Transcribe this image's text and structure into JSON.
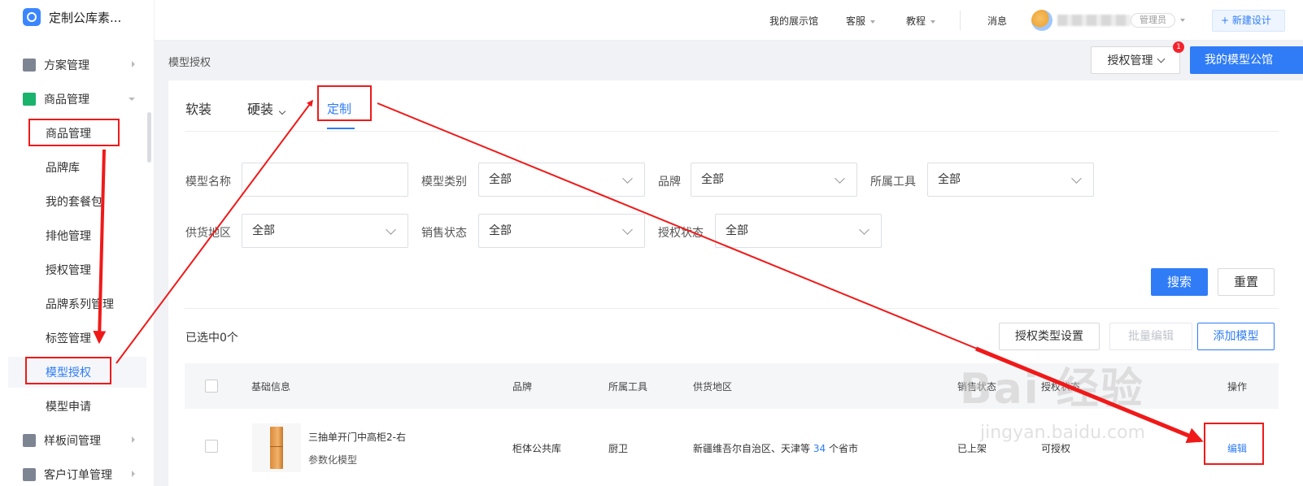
{
  "app": {
    "title": "定制公库素..."
  },
  "sidebar": {
    "groups": [
      {
        "label": "方案管理"
      },
      {
        "label": "商品管理"
      },
      {
        "label": "样板间管理"
      },
      {
        "label": "客户订单管理"
      }
    ],
    "sub_items": [
      {
        "label": "商品管理"
      },
      {
        "label": "品牌库"
      },
      {
        "label": "我的套餐包"
      },
      {
        "label": "排他管理"
      },
      {
        "label": "授权管理"
      },
      {
        "label": "品牌系列管理"
      },
      {
        "label": "标签管理"
      },
      {
        "label": "模型授权"
      },
      {
        "label": "模型申请"
      }
    ]
  },
  "topbar": {
    "showroom": "我的展示馆",
    "service": "客服",
    "tutorial": "教程",
    "messages": "消息",
    "role": "管理员",
    "new_design": "+ 新建设计"
  },
  "header": {
    "breadcrumb": "模型授权",
    "auth_manage": "授权管理",
    "badge_count": "1",
    "my_library": "我的模型公馆"
  },
  "tabs": [
    {
      "label": "软装"
    },
    {
      "label": "硬装"
    },
    {
      "label": "定制"
    }
  ],
  "filters": {
    "model_name": {
      "label": "模型名称",
      "value": ""
    },
    "model_type": {
      "label": "模型类别",
      "value": "全部"
    },
    "brand": {
      "label": "品牌",
      "value": "全部"
    },
    "tool": {
      "label": "所属工具",
      "value": "全部"
    },
    "region": {
      "label": "供货地区",
      "value": "全部"
    },
    "sale_status": {
      "label": "销售状态",
      "value": "全部"
    },
    "auth_status": {
      "label": "授权状态",
      "value": "全部"
    }
  },
  "actions": {
    "search": "搜索",
    "reset": "重置",
    "selected": "已选中0个",
    "auth_type_setting": "授权类型设置",
    "batch_edit": "批量编辑",
    "add_model": "添加模型"
  },
  "table": {
    "columns": [
      "基础信息",
      "品牌",
      "所属工具",
      "供货地区",
      "销售状态",
      "授权状态",
      "操作"
    ],
    "rows": [
      {
        "name": "三抽单开门中高柜2-右",
        "kind": "参数化模型",
        "brand": "柜体公共库",
        "tool": "厨卫",
        "region_prefix": "新疆维吾尔自治区、天津等",
        "region_count": "34",
        "region_suffix": "个省市",
        "sale_status": "已上架",
        "auth_status": "可授权",
        "action": "编辑"
      }
    ]
  },
  "watermark": {
    "main": "Bai 经验",
    "sub": "jingyan.baidu.com"
  },
  "colors": {
    "accent": "#2f7cf6",
    "annotation": "#f01919"
  }
}
